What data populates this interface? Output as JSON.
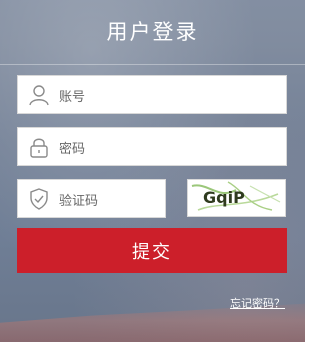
{
  "header": {
    "title": "用户登录"
  },
  "form": {
    "username_placeholder": "账号",
    "password_placeholder": "密码",
    "captcha_placeholder": "验证码",
    "captcha_text": "GqiP",
    "submit_label": "提交",
    "forgot_label": "忘记密码？"
  },
  "icons": {
    "username": "user-icon",
    "password": "lock-icon",
    "captcha": "shield-check-icon"
  },
  "colors": {
    "submit_bg": "#cc1f2a",
    "panel_bg": "#74839c",
    "title_text": "#ffffff"
  }
}
